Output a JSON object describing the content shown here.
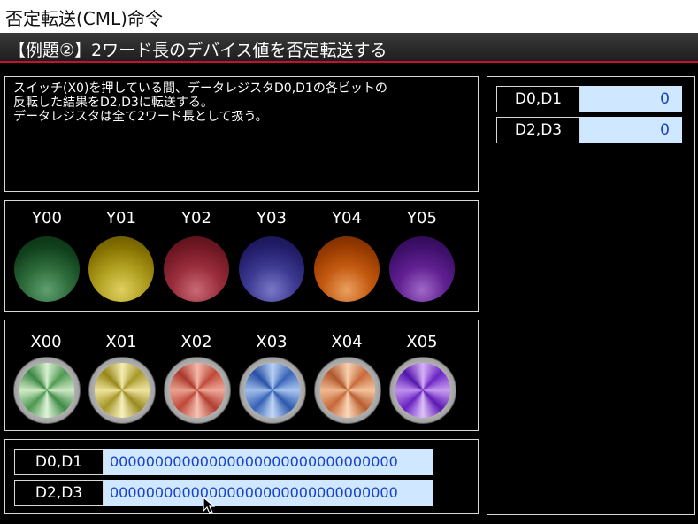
{
  "title": "否定転送(CML)命令",
  "subtitle": "【例題②】2ワード長のデバイス値を否定転送する",
  "description": [
    "スイッチ(X0)を押している間、データレジスタD0,D1の各ビットの",
    "反転した結果をD2,D3に転送する。",
    "データレジスタは全て2ワード長として扱う。"
  ],
  "lamps": [
    {
      "label": "Y00",
      "color": "green"
    },
    {
      "label": "Y01",
      "color": "yellow"
    },
    {
      "label": "Y02",
      "color": "red"
    },
    {
      "label": "Y03",
      "color": "blue"
    },
    {
      "label": "Y04",
      "color": "orange"
    },
    {
      "label": "Y05",
      "color": "purple"
    }
  ],
  "buttons": [
    {
      "label": "X00",
      "color": "green"
    },
    {
      "label": "X01",
      "color": "yellow"
    },
    {
      "label": "X02",
      "color": "red"
    },
    {
      "label": "X03",
      "color": "blue"
    },
    {
      "label": "X04",
      "color": "orange"
    },
    {
      "label": "X05",
      "color": "purple"
    }
  ],
  "binary_registers": [
    {
      "label": "D0,D1",
      "value": "00000000000000000000000000000000"
    },
    {
      "label": "D2,D3",
      "value": "00000000000000000000000000000000"
    }
  ],
  "decimal_registers": [
    {
      "label": "D0,D1",
      "value": "0"
    },
    {
      "label": "D2,D3",
      "value": "0"
    }
  ],
  "colors": {
    "accent": "#c8102e",
    "value_bg": "#cfe8ff",
    "value_text": "#1840c8"
  }
}
